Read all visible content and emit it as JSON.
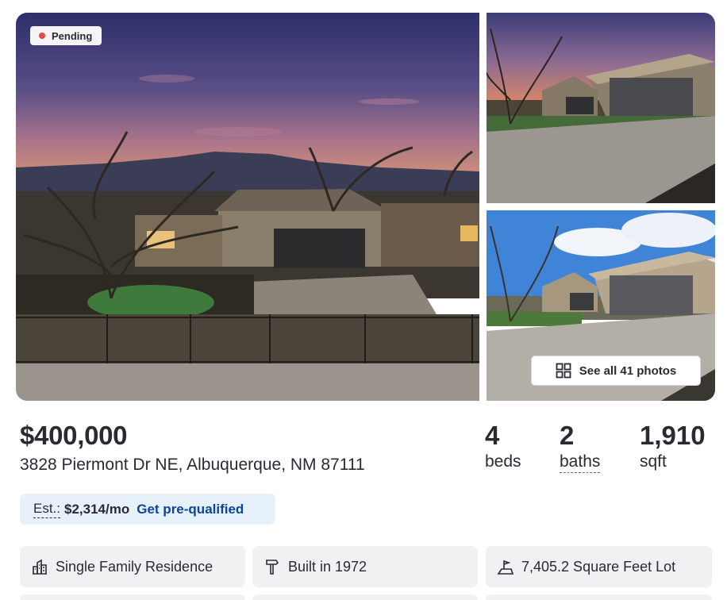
{
  "listing": {
    "status": "Pending",
    "see_all_label": "See all 41 photos",
    "price": "$400,000",
    "address": "3828 Piermont Dr NE, Albuquerque, NM 87111",
    "stats": {
      "beds_value": "4",
      "beds_label": "beds",
      "baths_value": "2",
      "baths_label": "baths",
      "sqft_value": "1,910",
      "sqft_label": "sqft"
    },
    "estimate": {
      "label": "Est.:",
      "amount": "$2,314/mo",
      "link": "Get pre-qualified"
    },
    "facts": [
      {
        "icon": "home-type-icon",
        "text": "Single Family Residence"
      },
      {
        "icon": "hammer-icon",
        "text": "Built in 1972"
      },
      {
        "icon": "lot-size-icon",
        "text": "7,405.2 Square Feet Lot"
      }
    ]
  },
  "colors": {
    "status_dot": "#e5484d",
    "link": "#0d4599",
    "estimate_bg": "#e7f1fb",
    "fact_bg": "#f1f1f4"
  }
}
